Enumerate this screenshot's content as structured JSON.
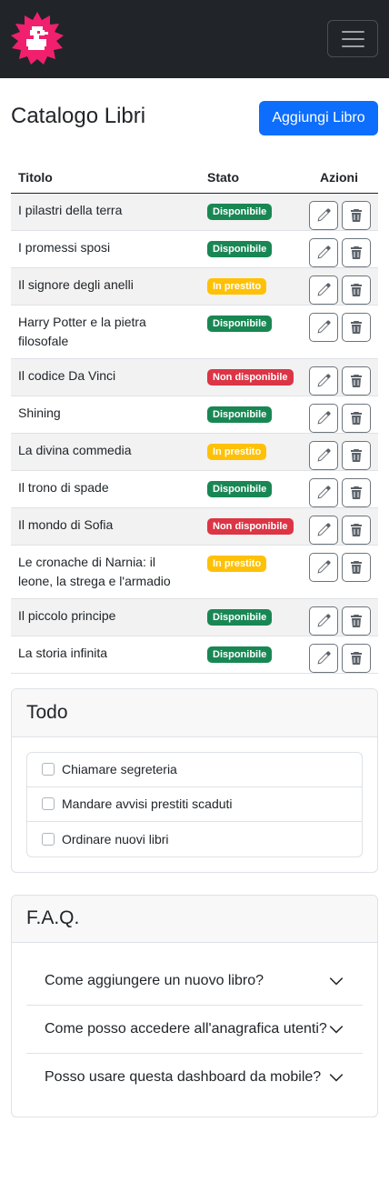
{
  "navbar": {
    "brand": "duck-logo",
    "toggler": "hamburger-icon"
  },
  "header": {
    "title": "Catalogo Libri",
    "add_label": "Aggiungi Libro"
  },
  "table": {
    "columns": [
      "Titolo",
      "Stato",
      "Azioni"
    ],
    "rows": [
      {
        "title": "I pilastri della terra",
        "status": "Disponibile"
      },
      {
        "title": "I promessi sposi",
        "status": "Disponibile"
      },
      {
        "title": "Il signore degli anelli",
        "status": "In prestito"
      },
      {
        "title": "Harry Potter e la pietra filosofale",
        "status": "Disponibile"
      },
      {
        "title": "Il codice Da Vinci",
        "status": "Non disponibile"
      },
      {
        "title": "Shining",
        "status": "Disponibile"
      },
      {
        "title": "La divina commedia",
        "status": "In prestito"
      },
      {
        "title": "Il trono di spade",
        "status": "Disponibile"
      },
      {
        "title": "Il mondo di Sofia",
        "status": "Non disponibile"
      },
      {
        "title": "Le cronache di Narnia: il leone, la strega e l'armadio",
        "status": "In prestito"
      },
      {
        "title": "Il piccolo principe",
        "status": "Disponibile"
      },
      {
        "title": "La storia infinita",
        "status": "Disponibile"
      }
    ],
    "status_colors": {
      "Disponibile": "#198754",
      "In prestito": "#ffc107",
      "Non disponibile": "#dc3545"
    }
  },
  "todo": {
    "title": "Todo",
    "items": [
      "Chiamare segreteria",
      "Mandare avvisi prestiti scaduti",
      "Ordinare nuovi libri"
    ]
  },
  "faq": {
    "title": "F.A.Q.",
    "items": [
      "Come aggiungere un nuovo libro?",
      "Come posso accedere all'anagrafica utenti?",
      "Posso usare questa dashboard da mobile?"
    ]
  },
  "colors": {
    "navbar": "#212529",
    "primary": "#0d6efd",
    "logo": "#f0206e"
  }
}
